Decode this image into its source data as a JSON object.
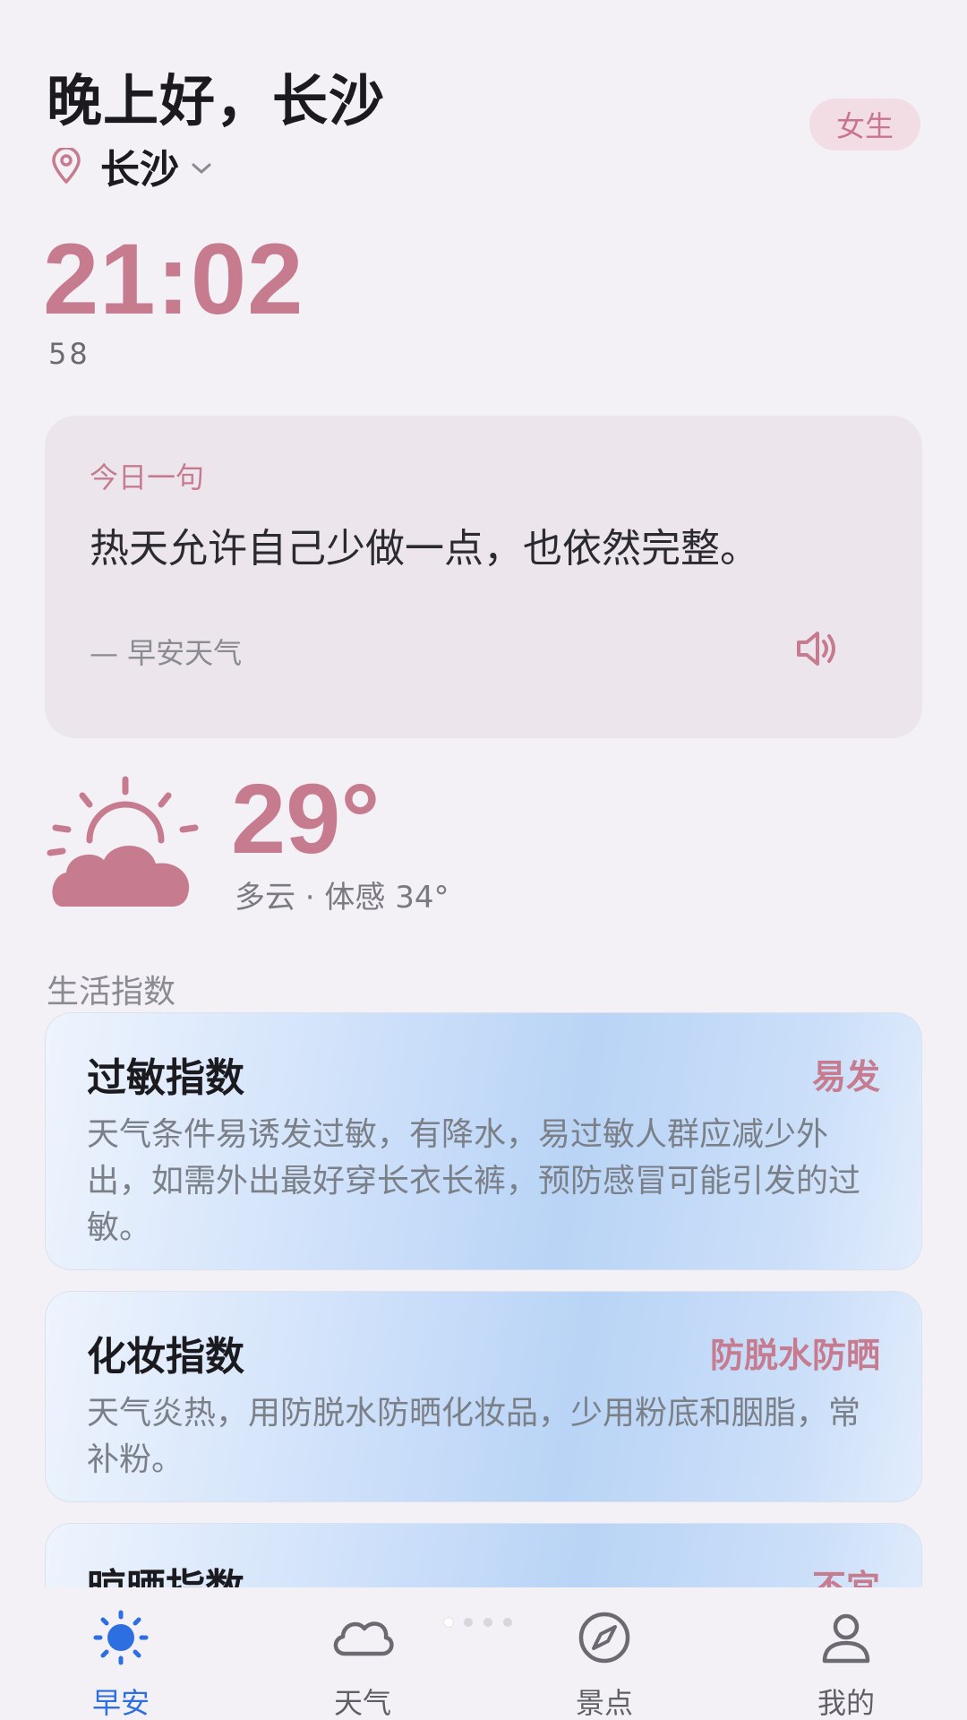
{
  "header": {
    "greeting": "晚上好，长沙",
    "city": "长沙",
    "voice_gender": "女生"
  },
  "clock": {
    "time": "21:02",
    "seconds": "58"
  },
  "quote": {
    "label": "今日一句",
    "text": "热天允许自己少做一点，也依然完整。",
    "source": "— 早安天气"
  },
  "weather": {
    "temperature": "29°",
    "description": "多云 · 体感 34°",
    "icon": "partly-cloudy-icon"
  },
  "life_index": {
    "title": "生活指数",
    "items": [
      {
        "name": "过敏指数",
        "level": "易发",
        "desc": "天气条件易诱发过敏，有降水，易过敏人群应减少外出，如需外出最好穿长衣长裤，预防感冒可能引发的过敏。"
      },
      {
        "name": "化妆指数",
        "level": "防脱水防晒",
        "desc": "天气炎热，用防脱水防晒化妆品，少用粉底和胭脂，常补粉。"
      },
      {
        "name": "晾晒指数",
        "level": "不宜",
        "desc": ""
      }
    ]
  },
  "pager": {
    "total": 4,
    "current": 1
  },
  "nav": {
    "items": [
      {
        "label": "早安",
        "icon": "sun-icon",
        "active": true
      },
      {
        "label": "天气",
        "icon": "cloud-icon",
        "active": false
      },
      {
        "label": "景点",
        "icon": "compass-icon",
        "active": false
      },
      {
        "label": "我的",
        "icon": "user-icon",
        "active": false
      }
    ]
  },
  "colors": {
    "accent_pink": "#c67b8f",
    "active_blue": "#2d6fe0",
    "background": "#f3f1f6"
  }
}
